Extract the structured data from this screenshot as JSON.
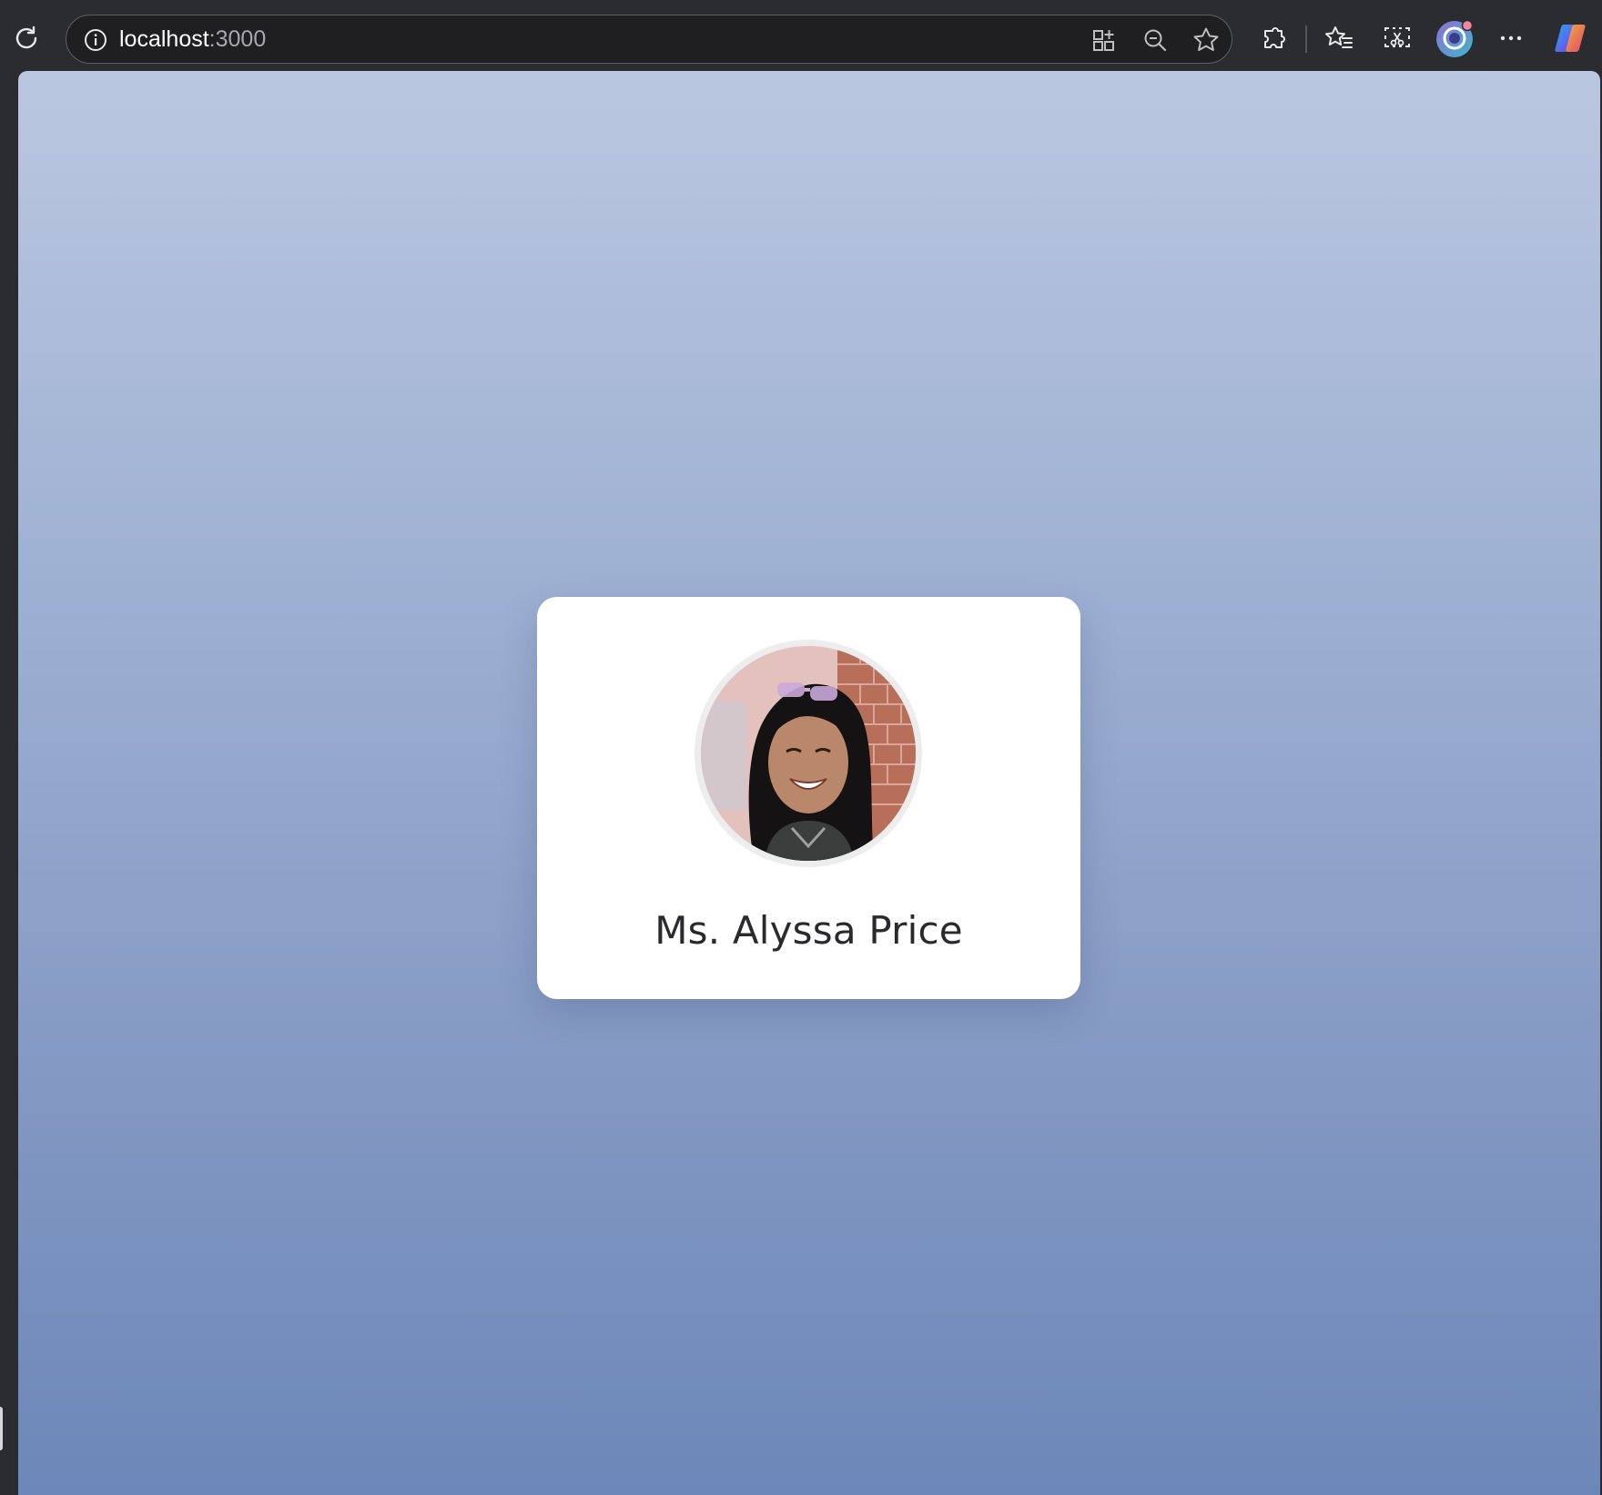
{
  "browser": {
    "address_bar": {
      "host": "localhost",
      "port": ":3000"
    },
    "icons": {
      "reload": "reload-icon",
      "site_info": "info-icon",
      "app_available": "app-grid-icon",
      "zoom": "zoom-out-icon",
      "favorite": "star-icon",
      "extensions": "puzzle-icon",
      "favorites": "favorites-list-icon",
      "screenshot": "screenshot-icon",
      "profile": "profile-avatar-icon",
      "more": "more-icon",
      "copilot": "copilot-icon"
    }
  },
  "page": {
    "background_colors": [
      "#bac7e0",
      "#6c87b9"
    ],
    "profile_card": {
      "name": "Ms. Alyssa Price"
    }
  }
}
